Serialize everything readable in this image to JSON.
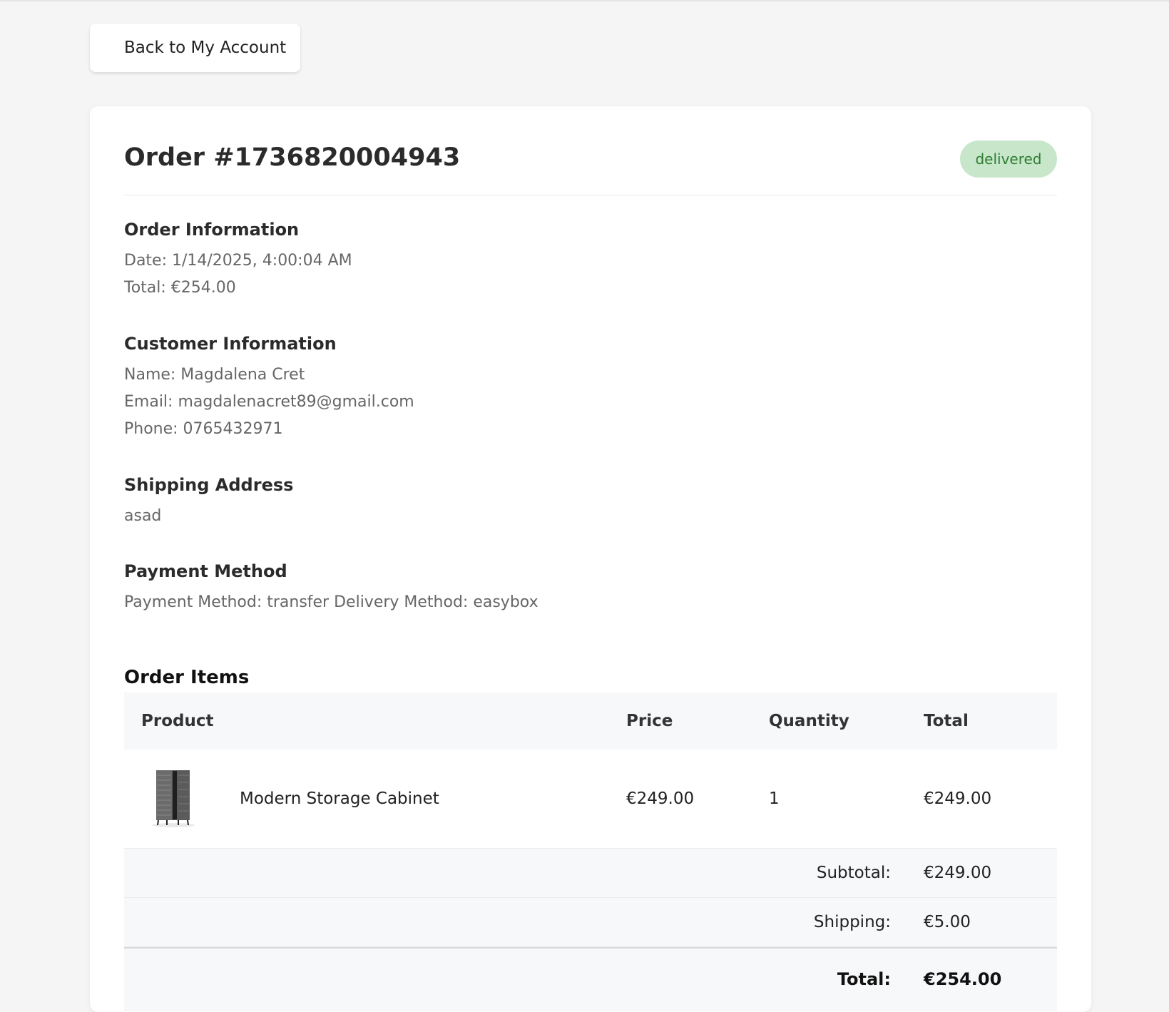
{
  "nav": {
    "back_label": "Back to My Account"
  },
  "order": {
    "title": "Order #1736820004943",
    "status": "delivered",
    "status_color": "#2e7d32",
    "status_bg": "#c8e6c9"
  },
  "order_info": {
    "heading": "Order Information",
    "date": "Date: 1/14/2025, 4:00:04 AM",
    "total": "Total: €254.00"
  },
  "customer_info": {
    "heading": "Customer Information",
    "name": "Name: Magdalena Cret",
    "email": "Email: magdalenacret89@gmail.com",
    "phone": "Phone: 0765432971"
  },
  "shipping": {
    "heading": "Shipping Address",
    "address": "asad"
  },
  "payment": {
    "heading": "Payment Method",
    "text": "Payment Method: transfer Delivery Method: easybox"
  },
  "items": {
    "heading": "Order Items",
    "columns": {
      "product": "Product",
      "price": "Price",
      "quantity": "Quantity",
      "total": "Total"
    },
    "rows": [
      {
        "image_icon": "cabinet-thumbnail",
        "name": "Modern Storage Cabinet",
        "price": "€249.00",
        "quantity": "1",
        "total": "€249.00"
      }
    ],
    "summary": {
      "subtotal_label": "Subtotal:",
      "subtotal_value": "€249.00",
      "shipping_label": "Shipping:",
      "shipping_value": "€5.00",
      "total_label": "Total:",
      "total_value": "€254.00"
    }
  }
}
